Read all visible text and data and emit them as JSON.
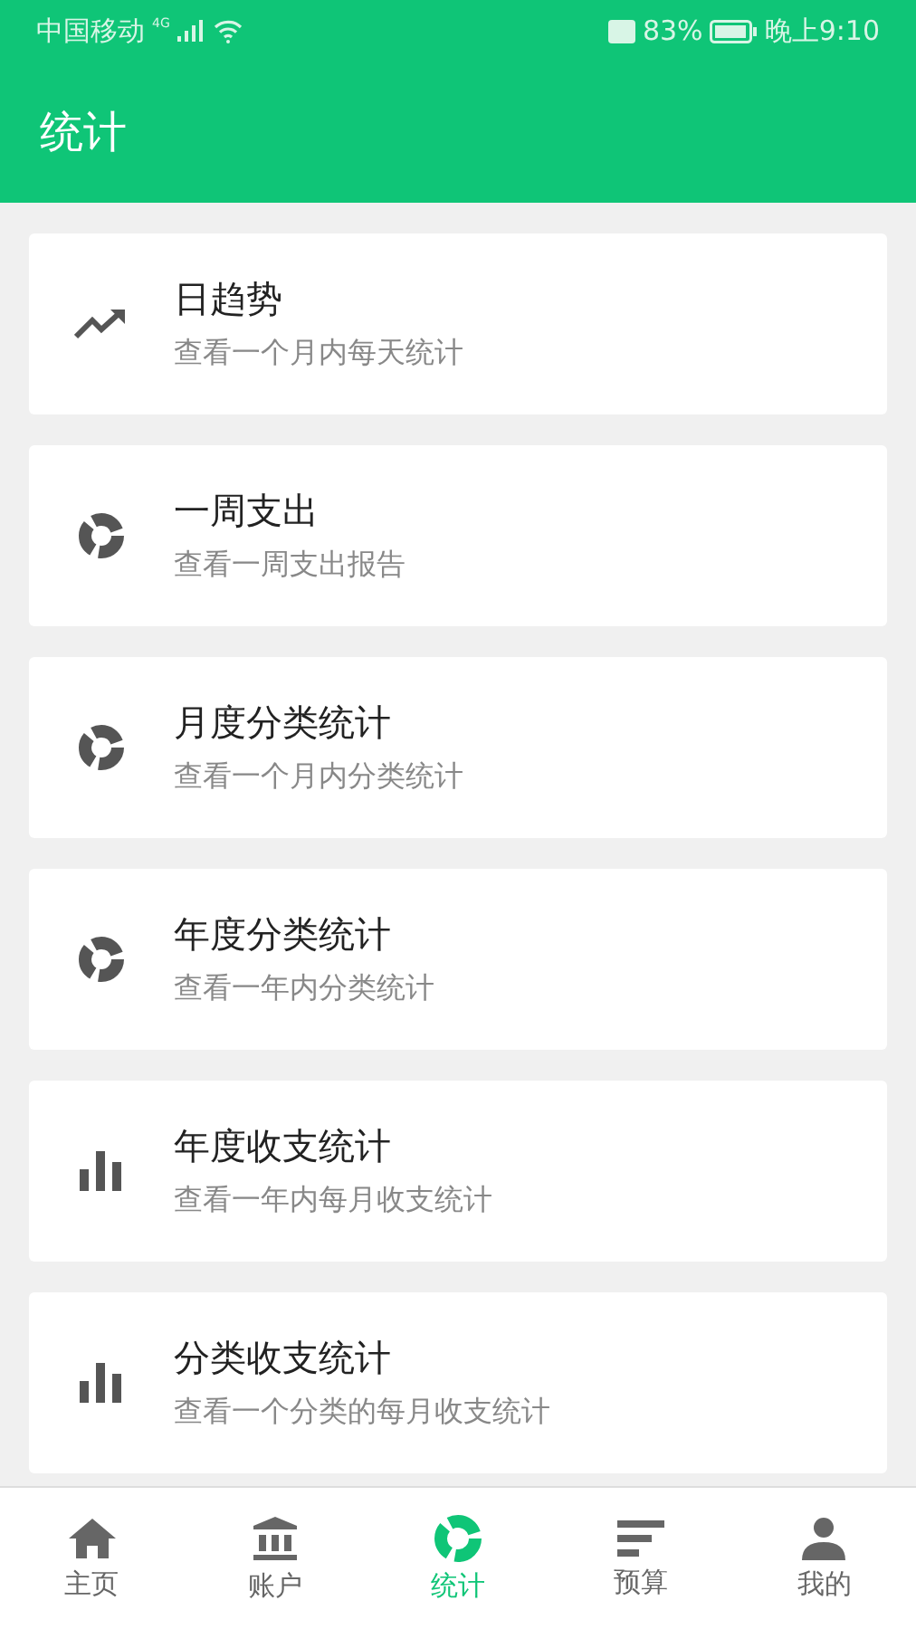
{
  "status_bar": {
    "carrier": "中国移动",
    "network": "4G",
    "battery": "83%",
    "time": "晚上9:10"
  },
  "header": {
    "title": "统计"
  },
  "items": [
    {
      "kind": "trend",
      "title": "日趋势",
      "subtitle": "查看一个月内每天统计"
    },
    {
      "kind": "donut",
      "title": "一周支出",
      "subtitle": "查看一周支出报告"
    },
    {
      "kind": "donut",
      "title": "月度分类统计",
      "subtitle": "查看一个月内分类统计"
    },
    {
      "kind": "donut",
      "title": "年度分类统计",
      "subtitle": "查看一年内分类统计"
    },
    {
      "kind": "bars",
      "title": "年度收支统计",
      "subtitle": "查看一年内每月收支统计"
    },
    {
      "kind": "bars",
      "title": "分类收支统计",
      "subtitle": "查看一个分类的每月收支统计"
    }
  ],
  "tabs": [
    {
      "kind": "home",
      "label": "主页",
      "selected": false
    },
    {
      "kind": "bank",
      "label": "账户",
      "selected": false
    },
    {
      "kind": "donut",
      "label": "统计",
      "selected": true
    },
    {
      "kind": "sort",
      "label": "预算",
      "selected": false
    },
    {
      "kind": "person",
      "label": "我的",
      "selected": false
    }
  ]
}
